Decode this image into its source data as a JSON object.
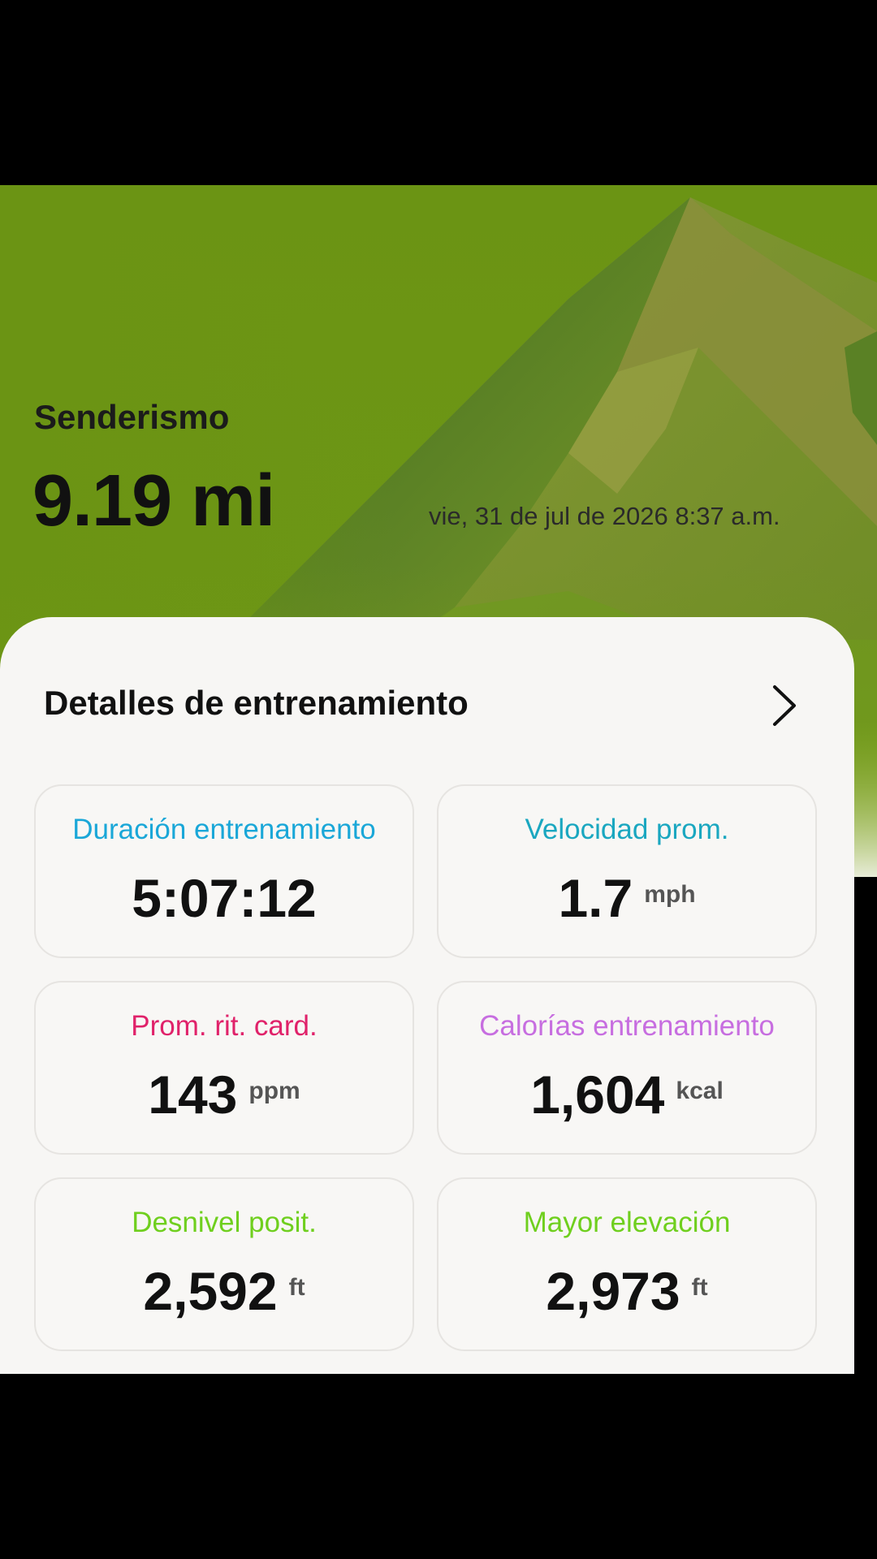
{
  "workout": {
    "type": "Senderismo",
    "distance": "9.19 mi",
    "datetime": "vie, 31 de jul de 2026 8:37 a.m."
  },
  "details": {
    "title": "Detalles de entrenamiento",
    "chevron_icon": "chevron-right-icon"
  },
  "stats": [
    {
      "label": "Duración entrenamiento",
      "value": "5:07:12",
      "unit": "",
      "color": "#1aa7d8"
    },
    {
      "label": "Velocidad prom.",
      "value": "1.7",
      "unit": "mph",
      "color": "#1aa7c0"
    },
    {
      "label": "Prom. rit. card.",
      "value": "143",
      "unit": "ppm",
      "color": "#e0226a"
    },
    {
      "label": "Calorías entrenamiento",
      "value": "1,604",
      "unit": "kcal",
      "color": "#c76ee0"
    },
    {
      "label": "Desnivel posit.",
      "value": "2,592",
      "unit": "ft",
      "color": "#6fcf1e"
    },
    {
      "label": "Mayor elevación",
      "value": "2,973",
      "unit": "ft",
      "color": "#6fcf1e"
    }
  ]
}
